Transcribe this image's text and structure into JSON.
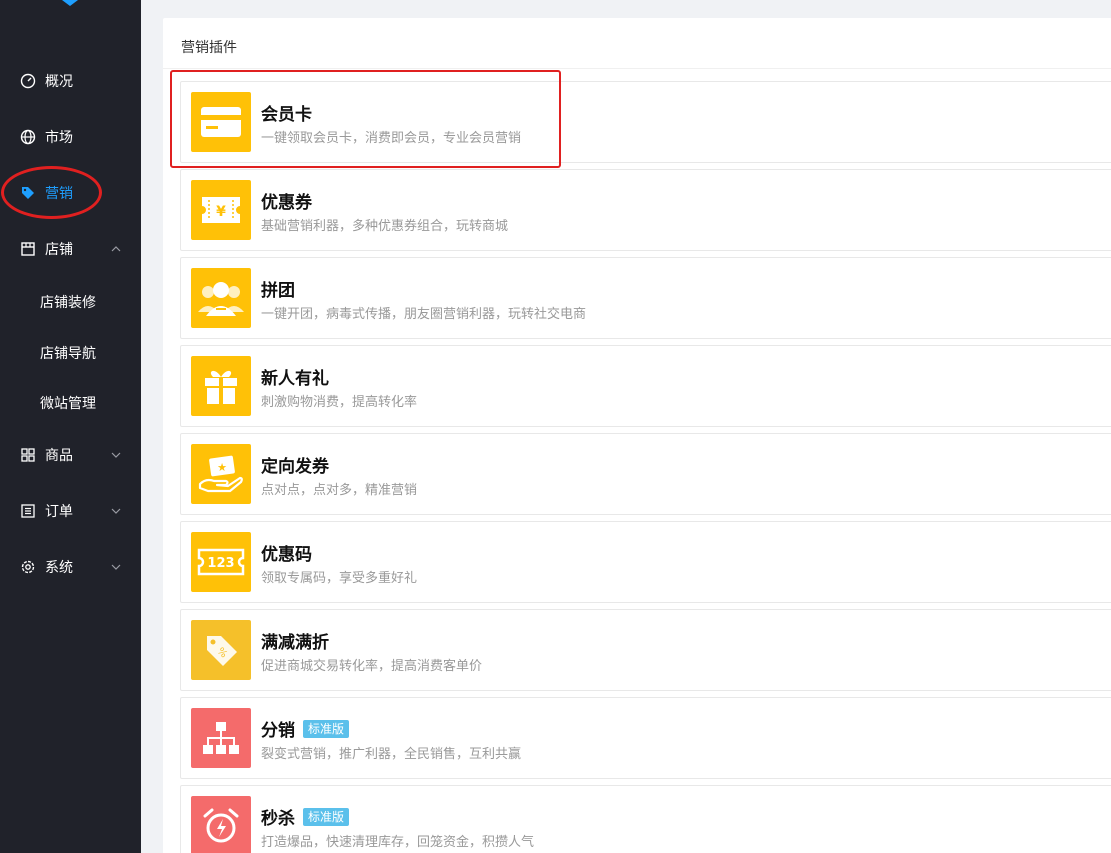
{
  "sidebar": {
    "items": [
      {
        "label": "概况",
        "icon": "dashboard-icon"
      },
      {
        "label": "市场",
        "icon": "globe-icon"
      },
      {
        "label": "营销",
        "icon": "tag-icon"
      },
      {
        "label": "店铺",
        "icon": "store-icon"
      },
      {
        "label": "商品",
        "icon": "grid-icon"
      },
      {
        "label": "订单",
        "icon": "list-icon"
      },
      {
        "label": "系统",
        "icon": "gear-icon"
      }
    ],
    "sub_items": [
      "店铺装修",
      "店铺导航",
      "微站管理"
    ],
    "active_color": "#1e9fff"
  },
  "panel": {
    "title": "营销插件"
  },
  "plugins": [
    {
      "name": "会员卡",
      "desc": "一键领取会员卡，消费即会员，专业会员营销",
      "badge": "",
      "icon": "membership-card-icon",
      "color": "#ffc107"
    },
    {
      "name": "优惠券",
      "desc": "基础营销利器，多种优惠券组合，玩转商城",
      "badge": "",
      "icon": "coupon-icon",
      "color": "#ffc107"
    },
    {
      "name": "拼团",
      "desc": "一键开团，病毒式传播，朋友圈营销利器，玩转社交电商",
      "badge": "",
      "icon": "group-buy-icon",
      "color": "#ffc107"
    },
    {
      "name": "新人有礼",
      "desc": "刺激购物消费，提高转化率",
      "badge": "",
      "icon": "gift-icon",
      "color": "#ffc107"
    },
    {
      "name": "定向发券",
      "desc": "点对点，点对多，精准营销",
      "badge": "",
      "icon": "hand-coupon-icon",
      "color": "#ffc107"
    },
    {
      "name": "优惠码",
      "desc": "领取专属码，享受多重好礼",
      "badge": "",
      "icon": "code-123-icon",
      "color": "#ffc107",
      "icon_text": "123"
    },
    {
      "name": "满减满折",
      "desc": "促进商城交易转化率，提高消费客单价",
      "badge": "",
      "icon": "price-tag-icon",
      "color": "#f5c02a"
    },
    {
      "name": "分销",
      "desc": "裂变式营销，推广利器，全民销售，互利共赢",
      "badge": "标准版",
      "icon": "hierarchy-icon",
      "color": "#f46b6b"
    },
    {
      "name": "秒杀",
      "desc": "打造爆品，快速清理库存，回笼资金，积攒人气",
      "badge": "标准版",
      "icon": "alarm-clock-icon",
      "color": "#f46b6b"
    }
  ]
}
